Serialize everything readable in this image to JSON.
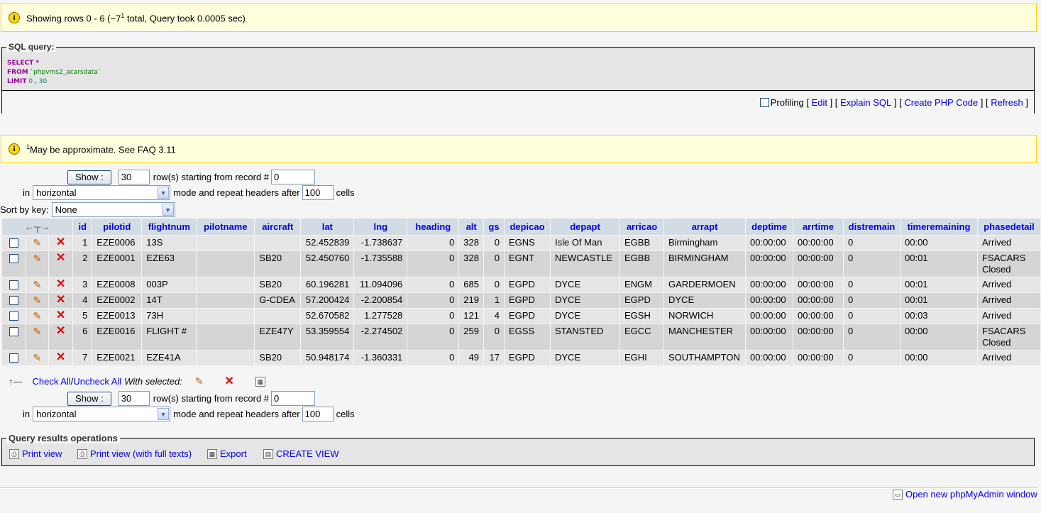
{
  "notice_top": {
    "text": "Showing rows 0 - 6 (~7",
    "sup": "1",
    "text_after": " total, Query took 0.0005 sec)"
  },
  "sql": {
    "legend": "SQL query:",
    "line1_kw": "SELECT",
    "line1_rest": " *",
    "line2_kw": "FROM",
    "line2_str": "`phpvms2_acarsdata`",
    "line3_kw": "LIMIT",
    "line3_num1": "0",
    "line3_sep": " , ",
    "line3_num2": "30",
    "profiling": "Profiling",
    "edit": "Edit",
    "explain": "Explain SQL",
    "php": "Create PHP Code",
    "refresh": "Refresh"
  },
  "notice_approx": {
    "sup": "1",
    "text": "May be approximate. See FAQ 3.11"
  },
  "nav_top": {
    "show": "Show :",
    "rows_value": "30",
    "rows_text": "row(s) starting from record #",
    "start_value": "0",
    "in_text": "in",
    "mode": "horizontal",
    "mode_text": "mode and repeat headers after",
    "repeat_value": "100",
    "cells_text": "cells"
  },
  "sort": {
    "label": "Sort by key:",
    "value": "None"
  },
  "table": {
    "columns": [
      "id",
      "pilotid",
      "flightnum",
      "pilotname",
      "aircraft",
      "lat",
      "lng",
      "heading",
      "alt",
      "gs",
      "depicao",
      "depapt",
      "arricao",
      "arrapt",
      "deptime",
      "arrtime",
      "distremain",
      "timeremaining",
      "phasedetail"
    ],
    "rows": [
      [
        "1",
        "EZE0006",
        "13S",
        "",
        "",
        "52.452839",
        "-1.738637",
        "0",
        "328",
        "0",
        "EGNS",
        "Isle Of Man",
        "EGBB",
        "Birmingham",
        "00:00:00",
        "00:00:00",
        "0",
        "00:00",
        "Arrived"
      ],
      [
        "2",
        "EZE0001",
        "EZE63",
        "",
        "SB20",
        "52.450760",
        "-1.735588",
        "0",
        "328",
        "0",
        "EGNT",
        "NEWCASTLE",
        "EGBB",
        "BIRMINGHAM",
        "00:00:00",
        "00:00:00",
        "0",
        "00:01",
        "FSACARS Closed"
      ],
      [
        "3",
        "EZE0008",
        "003P",
        "",
        "SB20",
        "60.196281",
        "11.094096",
        "0",
        "685",
        "0",
        "EGPD",
        "DYCE",
        "ENGM",
        "GARDERMOEN",
        "00:00:00",
        "00:00:00",
        "0",
        "00:01",
        "Arrived"
      ],
      [
        "4",
        "EZE0002",
        "14T",
        "",
        "G-CDEA",
        "57.200424",
        "-2.200854",
        "0",
        "219",
        "1",
        "EGPD",
        "DYCE",
        "EGPD",
        "DYCE",
        "00:00:00",
        "00:00:00",
        "0",
        "00:01",
        "Arrived"
      ],
      [
        "5",
        "EZE0013",
        "73H",
        "",
        "",
        "52.670582",
        "1.277528",
        "0",
        "121",
        "4",
        "EGPD",
        "DYCE",
        "EGSH",
        "NORWICH",
        "00:00:00",
        "00:00:00",
        "0",
        "00:03",
        "Arrived"
      ],
      [
        "6",
        "EZE0016",
        "FLIGHT #",
        "",
        "EZE47Y",
        "53.359554",
        "-2.274502",
        "0",
        "259",
        "0",
        "EGSS",
        "STANSTED",
        "EGCC",
        "MANCHESTER",
        "00:00:00",
        "00:00:00",
        "0",
        "00:00",
        "FSACARS Closed"
      ],
      [
        "7",
        "EZE0021",
        "EZE41A",
        "",
        "SB20",
        "50.948174",
        "-1.360331",
        "0",
        "49",
        "17",
        "EGPD",
        "DYCE",
        "EGHI",
        "SOUTHAMPTON",
        "00:00:00",
        "00:00:00",
        "0",
        "00:00",
        "Arrived"
      ]
    ]
  },
  "selection": {
    "check_all": "Check All",
    "sep": " / ",
    "uncheck_all": "Uncheck All",
    "with_selected": "With selected:"
  },
  "ops": {
    "legend": "Query results operations",
    "print": "Print view",
    "print_full": "Print view (with full texts)",
    "export": "Export",
    "create_view": "CREATE VIEW"
  },
  "footer": {
    "new_window": "Open new phpMyAdmin window"
  },
  "colors": {
    "header_bg": "#d3dce3",
    "row_odd": "#e5e5e5",
    "row_even": "#d5d5d5",
    "link": "#0000ee",
    "notice_bg": "#ffffdd"
  }
}
